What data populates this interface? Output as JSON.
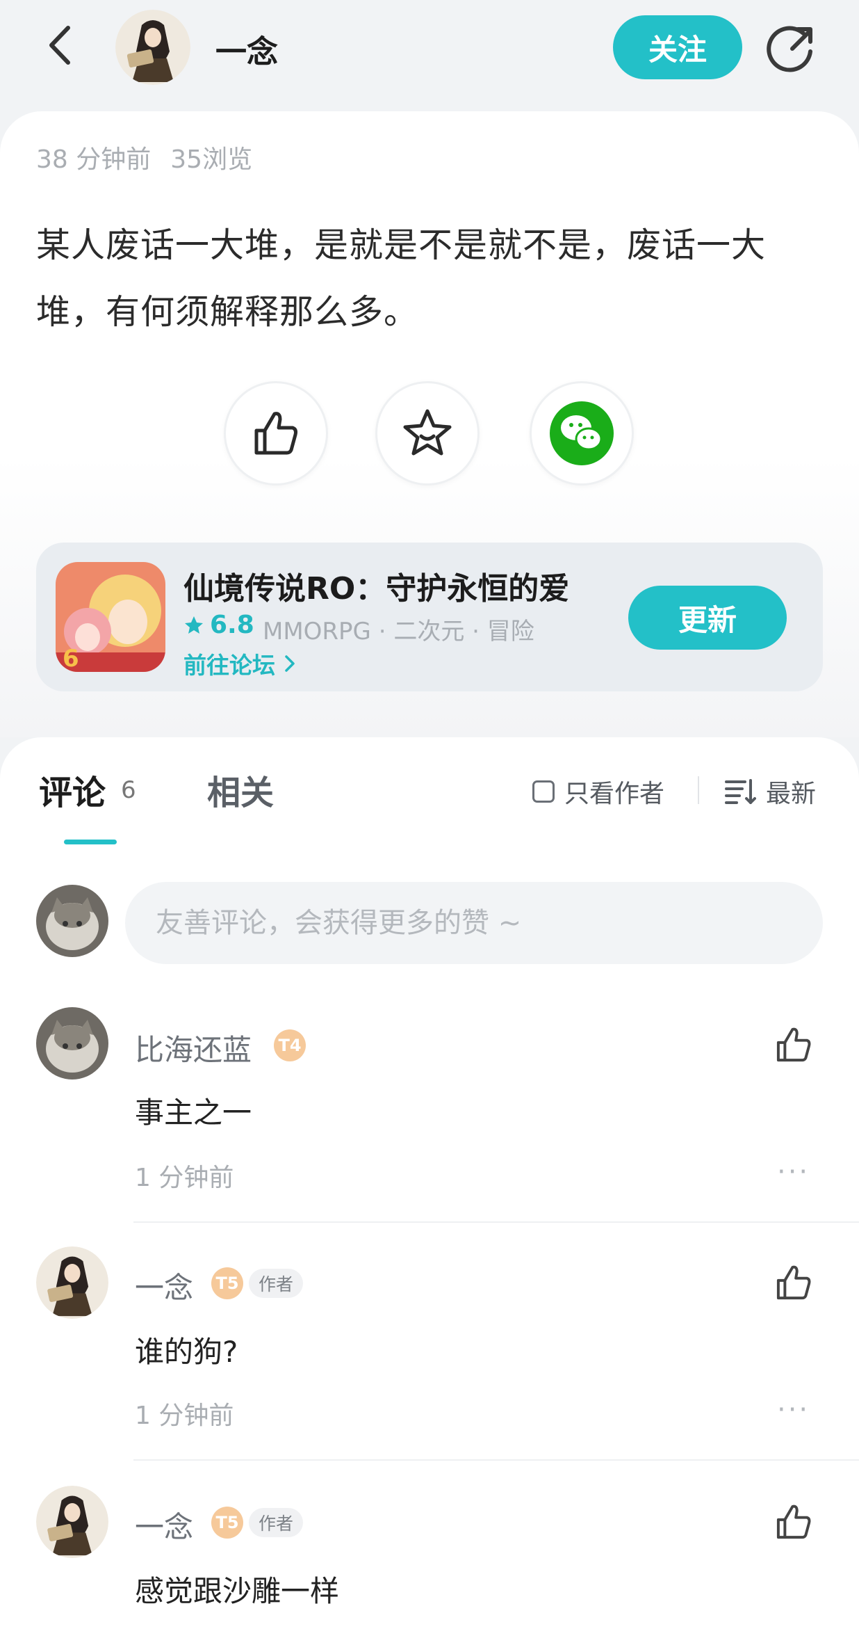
{
  "header": {
    "author_name": "一念",
    "follow_label": "关注"
  },
  "post": {
    "time": "38 分钟前",
    "views": "35浏览",
    "body": "某人废话一大堆，是就是不是就不是，废话一大堆，有何须解释那么多。"
  },
  "game": {
    "title": "仙境传说RO：守护永恒的爱",
    "rating": "6.8",
    "tags": "MMORPG · 二次元 · 冒险",
    "forum_link": "前往论坛",
    "update_label": "更新"
  },
  "comments_section": {
    "tab_comments": "评论",
    "comment_count": "6",
    "tab_related": "相关",
    "filter_author": "只看作者",
    "sort_latest": "最新",
    "input_placeholder": "友善评论，会获得更多的赞 ~"
  },
  "comments": [
    {
      "name": "比海还蓝",
      "level": "T4",
      "text": "事主之一",
      "time": "1 分钟前"
    },
    {
      "name": "一念",
      "level": "T5",
      "tag": "作者",
      "text": "谁的狗?",
      "time": "1 分钟前"
    },
    {
      "name": "一念",
      "level": "T5",
      "tag": "作者",
      "text": "感觉跟沙雕一样"
    }
  ],
  "colors": {
    "accent": "#23c0c8",
    "wechat_green": "#1aad19",
    "background": "#f1f3f5"
  },
  "icons": {
    "back": "chevron-left-icon",
    "share": "share-arrow-icon",
    "like": "thumbs-up-icon",
    "favorite": "star-icon",
    "wechat": "wechat-icon",
    "sort": "sort-lines-icon"
  }
}
